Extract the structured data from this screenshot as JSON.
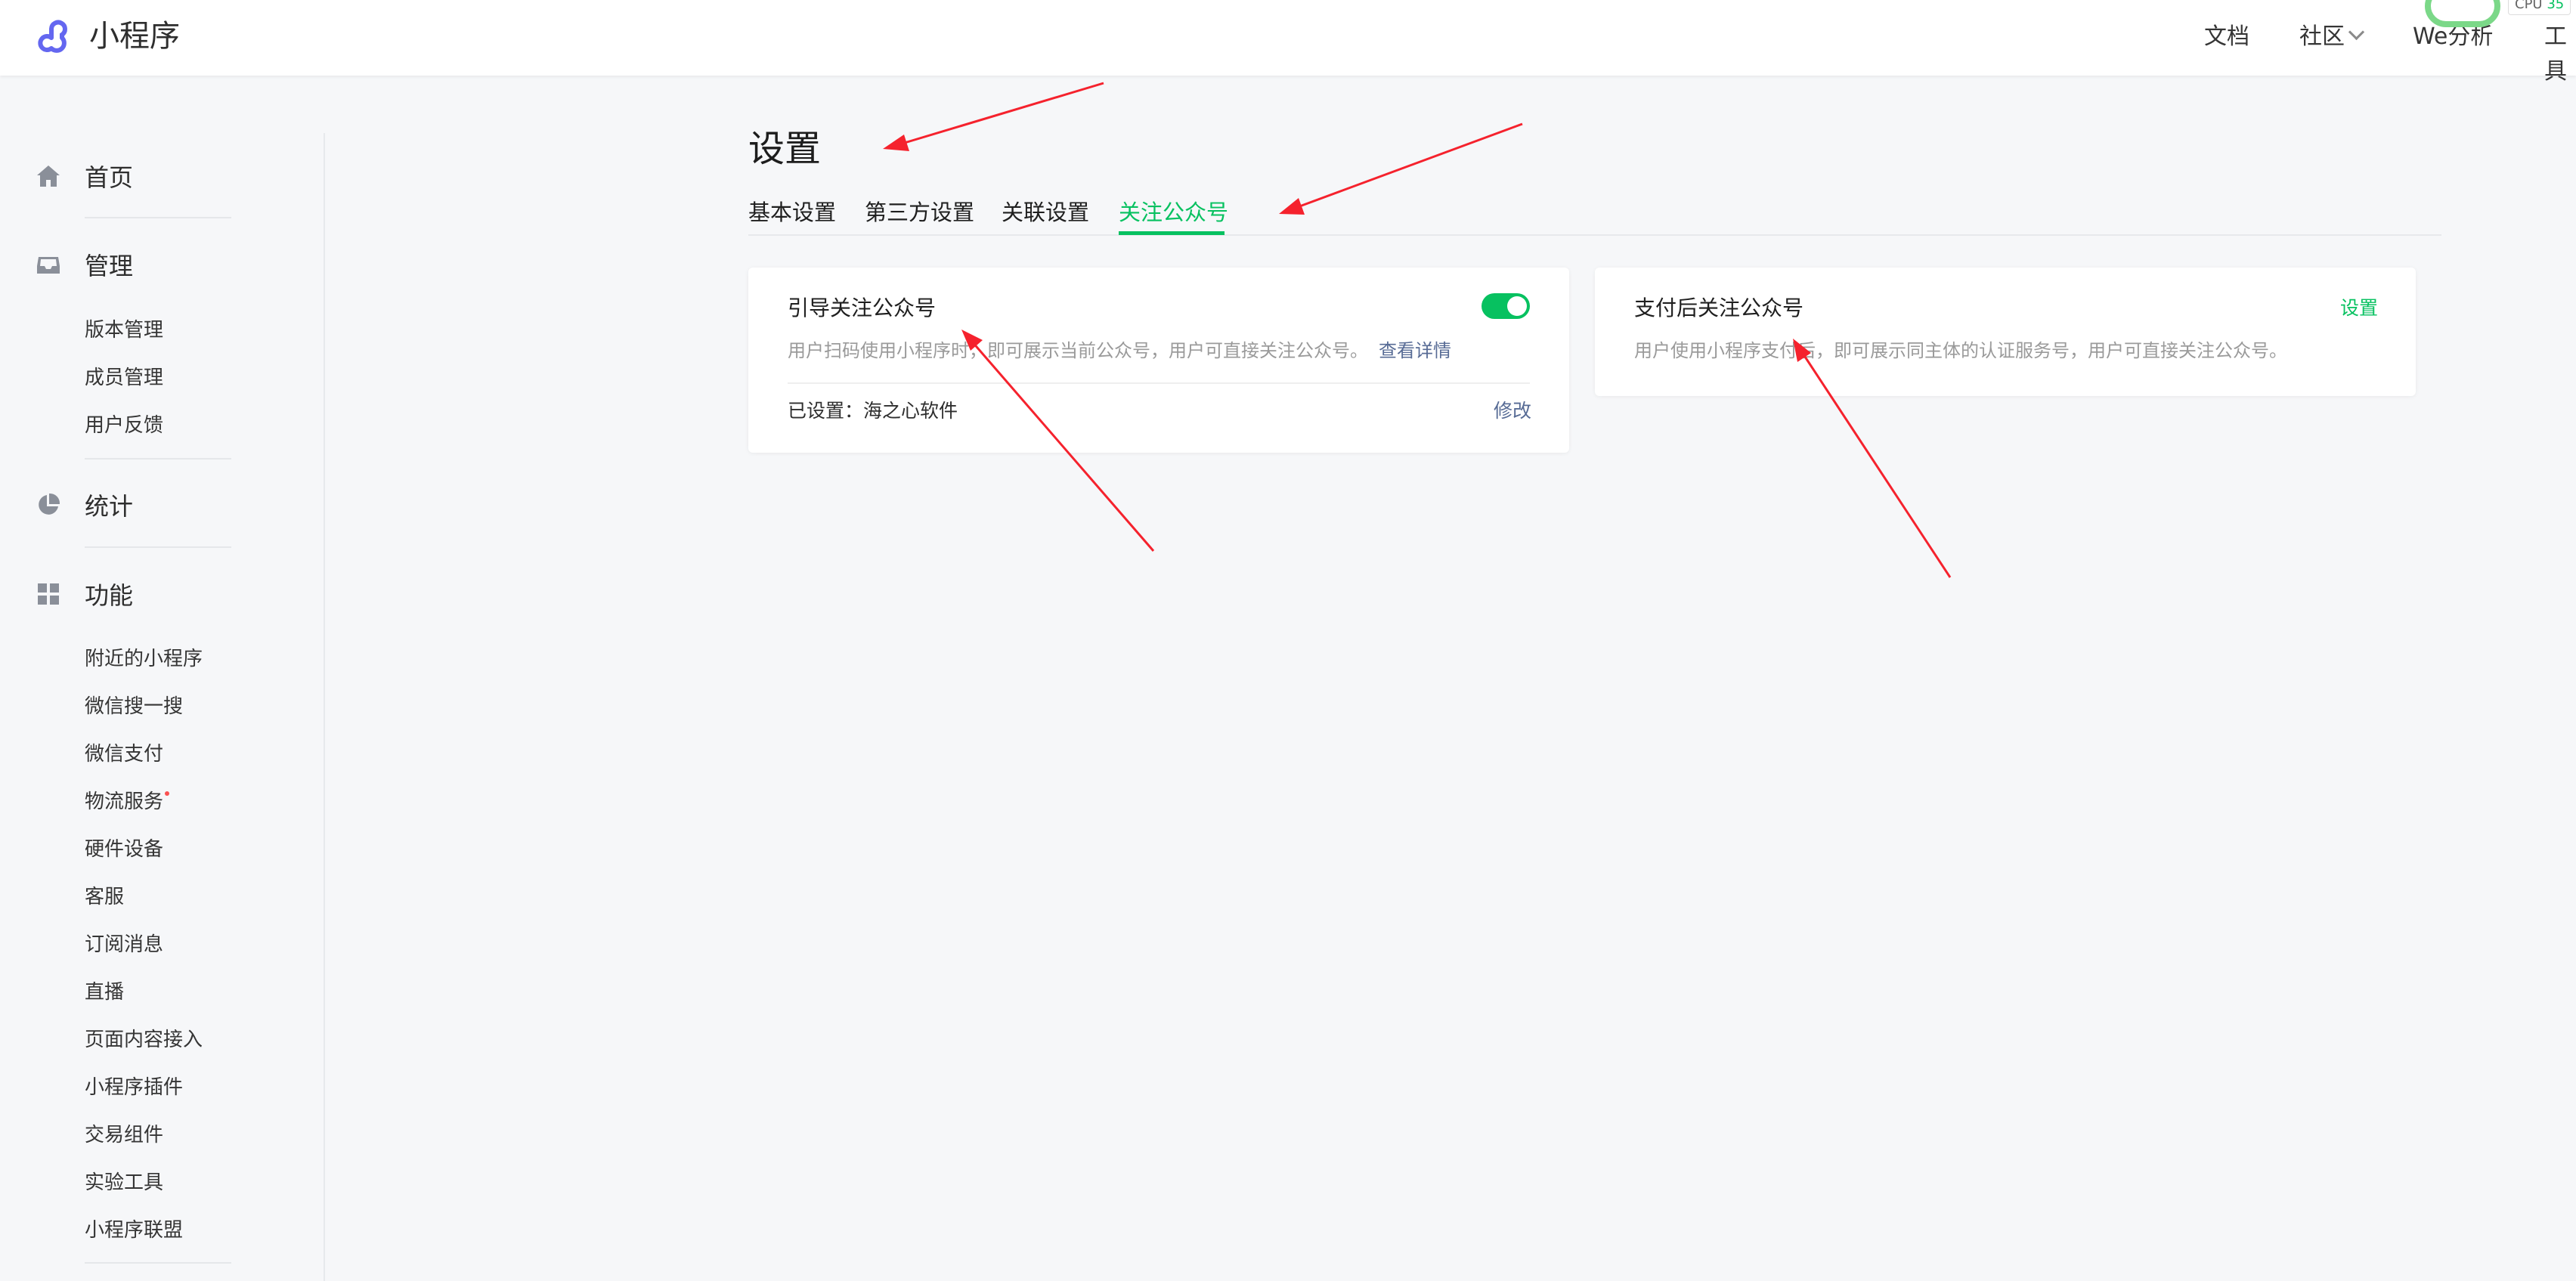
{
  "header": {
    "brand": "小程序",
    "nav": {
      "docs": "文档",
      "community": "社区",
      "analytics": "We分析",
      "tools": "工具"
    },
    "monitor": {
      "cpu_label": "CPU",
      "cpu_value": "35"
    }
  },
  "sidebar": {
    "home": "首页",
    "manage": {
      "label": "管理",
      "items": [
        "版本管理",
        "成员管理",
        "用户反馈"
      ]
    },
    "stats": "统计",
    "features": {
      "label": "功能",
      "items": [
        "附近的小程序",
        "微信搜一搜",
        "微信支付",
        "物流服务",
        "硬件设备",
        "客服",
        "订阅消息",
        "直播",
        "页面内容接入",
        "小程序插件",
        "交易组件",
        "实验工具",
        "小程序联盟"
      ]
    }
  },
  "page": {
    "title": "设置",
    "tabs": [
      "基本设置",
      "第三方设置",
      "关联设置",
      "关注公众号"
    ],
    "active_tab": "关注公众号"
  },
  "cards": {
    "guide_follow": {
      "title": "引导关注公众号",
      "description": "用户扫码使用小程序时，即可展示当前公众号，用户可直接关注公众号。",
      "detail_link": "查看详情",
      "setting_text": "已设置：海之心软件",
      "edit_label": "修改",
      "enabled": true
    },
    "pay_follow": {
      "title": "支付后关注公众号",
      "description": "用户使用小程序支付后，即可展示同主体的认证服务号，用户可直接关注公众号。",
      "set_label": "设置"
    }
  },
  "colors": {
    "accent_green": "#07c160",
    "link_blue": "#576b95",
    "annotation_red": "#f5222d"
  }
}
